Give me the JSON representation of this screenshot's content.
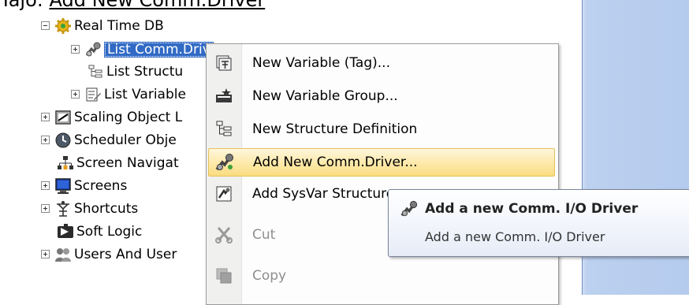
{
  "header": {
    "prefix": "Tajo: ",
    "underlined": "Add New Comm.Driver"
  },
  "tree": {
    "items": [
      {
        "label": "Real Time DB"
      },
      {
        "label": "List Comm.Driv"
      },
      {
        "label": "List Structu"
      },
      {
        "label": "List Variable"
      },
      {
        "label": "Scaling Object L"
      },
      {
        "label": "Scheduler Obje"
      },
      {
        "label": "Screen Navigat"
      },
      {
        "label": "Screens"
      },
      {
        "label": "Shortcuts"
      },
      {
        "label": "Soft Logic"
      },
      {
        "label": "Users And User"
      }
    ]
  },
  "context_menu": {
    "items": [
      {
        "label": "New Variable (Tag)...",
        "icon": "tag-icon"
      },
      {
        "label": "New Variable Group...",
        "icon": "variable-group-icon"
      },
      {
        "label": "New Structure Definition",
        "icon": "structure-icon"
      },
      {
        "label": "Add New Comm.Driver...",
        "icon": "comm-driver-icon"
      },
      {
        "label": "Add SysVar Structure...",
        "icon": "sysvar-icon"
      },
      {
        "label": "Cut",
        "icon": "scissors-icon"
      },
      {
        "label": "Copy",
        "icon": "copy-icon"
      }
    ]
  },
  "tooltip": {
    "title": "Add a new Comm. I/O Driver",
    "description": "Add a new Comm. I/O Driver"
  },
  "colors": {
    "selection": "#316ac5",
    "menu_highlight": "#fde9a8",
    "right_panel": "#b5cbee"
  }
}
